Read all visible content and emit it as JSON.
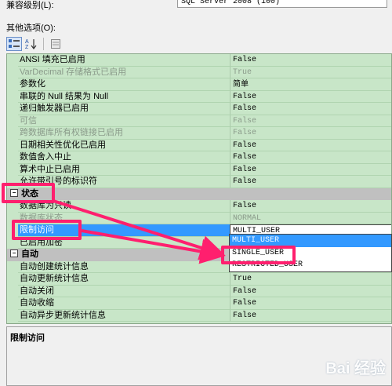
{
  "compat": {
    "label": "兼容级别(L):",
    "value": "SQL Server 2008 (100)"
  },
  "other_options_label": "其他选项(O):",
  "properties": [
    {
      "name": "ANSI 填充已启用",
      "value": "False",
      "dim": false
    },
    {
      "name": "VarDecimal 存储格式已启用",
      "value": "True",
      "dim": true
    },
    {
      "name": "参数化",
      "value": "简单",
      "dim": false
    },
    {
      "name": "串联的 Null 结果为 Null",
      "value": "False",
      "dim": false
    },
    {
      "name": "递归触发器已启用",
      "value": "False",
      "dim": false
    },
    {
      "name": "可信",
      "value": "False",
      "dim": true
    },
    {
      "name": "跨数据库所有权链接已启用",
      "value": "False",
      "dim": true
    },
    {
      "name": "日期相关性优化已启用",
      "value": "False",
      "dim": false
    },
    {
      "name": "数值舍入中止",
      "value": "False",
      "dim": false
    },
    {
      "name": "算术中止已启用",
      "value": "False",
      "dim": false
    },
    {
      "name": "允许带引号的标识符",
      "value": "False",
      "dim": false
    }
  ],
  "state_category": "状态",
  "state_rows": [
    {
      "name": "数据库为只读",
      "value": "False",
      "dim": false
    },
    {
      "name": "数据库状态",
      "value": "NORMAL",
      "dim": true
    },
    {
      "name": "限制访问",
      "value": "MULTI_USER",
      "dim": false
    },
    {
      "name": "已启用加密",
      "value": "",
      "dim": false
    }
  ],
  "auto_category": "自动",
  "auto_rows": [
    {
      "name": "自动创建统计信息",
      "value": "",
      "dim": false
    },
    {
      "name": "自动更新统计信息",
      "value": "True",
      "dim": false
    },
    {
      "name": "自动关闭",
      "value": "False",
      "dim": false
    },
    {
      "name": "自动收缩",
      "value": "False",
      "dim": false
    },
    {
      "name": "自动异步更新统计信息",
      "value": "False",
      "dim": false
    }
  ],
  "dropdown_options": [
    "MULTI_USER",
    "SINGLE_USER",
    "RESTRICTED_USER"
  ],
  "dropdown_highlight": "MULTI_USER",
  "description_title": "限制访问",
  "watermark": "Bai 经验",
  "colors": {
    "annotation": "#ff1f6e",
    "selection": "#3399ff",
    "grid_bg": "#c8e6c8"
  }
}
